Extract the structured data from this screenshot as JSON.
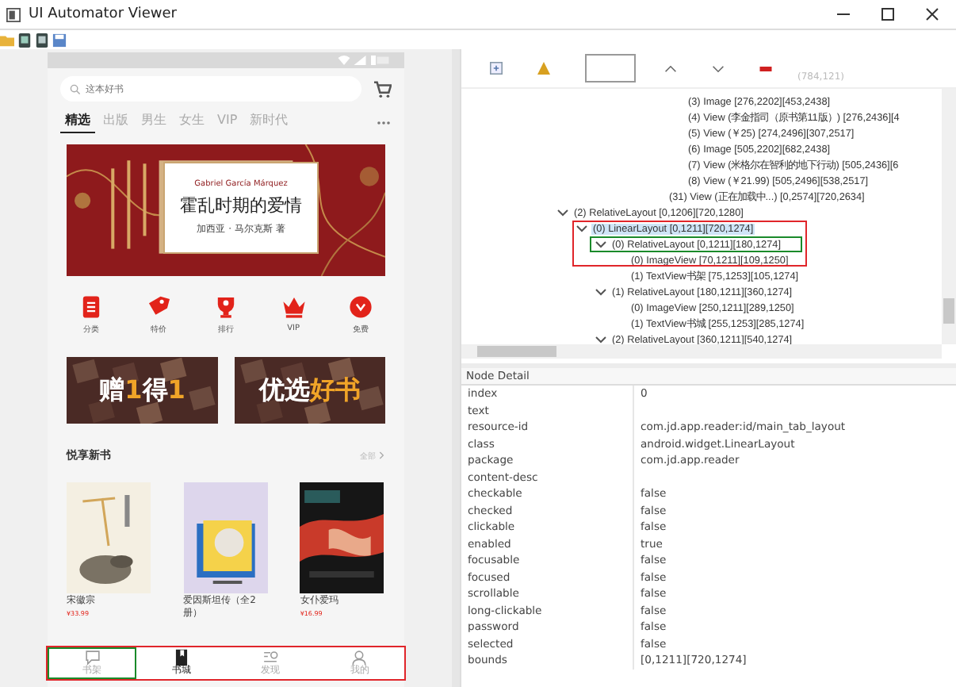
{
  "window": {
    "title": "UI Automator Viewer"
  },
  "phone": {
    "search": {
      "placeholder": "这本好书"
    },
    "tabs": [
      {
        "label": "精选",
        "selected": true
      },
      {
        "label": "出版",
        "selected": false
      },
      {
        "label": "男生",
        "selected": false
      },
      {
        "label": "女生",
        "selected": false
      },
      {
        "label": "VIP",
        "selected": false
      },
      {
        "label": "新时代",
        "selected": false
      }
    ],
    "banner": {
      "author_en": "Gabriel García Márquez",
      "title": "霍乱时期的爱情",
      "byline": "加西亚 · 马尔克斯 著"
    },
    "shortcuts": [
      {
        "label": "分类",
        "kind": "list"
      },
      {
        "label": "特价",
        "kind": "tag"
      },
      {
        "label": "排行",
        "kind": "trophy"
      },
      {
        "label": "VIP",
        "kind": "crown"
      },
      {
        "label": "免费",
        "kind": "gift"
      }
    ],
    "promos": [
      {
        "white": "赠",
        "accent": "1",
        "white2": "得",
        "accent2": "1"
      },
      {
        "white": "优选",
        "accent": "好书"
      }
    ],
    "section": {
      "title": "悦享新书",
      "more": "全部"
    },
    "books": [
      {
        "title": "宋徽宗",
        "price": "¥33.99",
        "kind": "sketch"
      },
      {
        "title": "爱因斯坦传（全2册）",
        "kind": "portrait"
      },
      {
        "title": "女仆爱玛",
        "price": "¥16.99",
        "kind": "dark"
      }
    ],
    "bottom_tabs": [
      {
        "label": "书架",
        "kind": "chat",
        "selected": false
      },
      {
        "label": "书城",
        "kind": "book",
        "selected": true
      },
      {
        "label": "发现",
        "kind": "search",
        "selected": false
      },
      {
        "label": "我的",
        "kind": "person",
        "selected": false
      }
    ]
  },
  "inspector": {
    "coords": "(784,121)",
    "tree": {
      "tail_nodes": [
        {
          "label": "(3) Image [276,2202][453,2438]",
          "selected": false
        },
        {
          "label": "(4) View (李金指司（原书第11版）) [276,2436][4",
          "selected": false
        },
        {
          "label": "(5) View (￥25) [274,2496][307,2517]",
          "selected": false
        },
        {
          "label": "(6) Image [505,2202][682,2438]",
          "selected": false
        },
        {
          "label": "(7) View (米格尔在智利的地下行动) [505,2436][6",
          "selected": false
        },
        {
          "label": "(8) View (￥21.99) [505,2496][538,2517]",
          "selected": false
        }
      ],
      "tail_sibling": {
        "label": "(31) View (正在加载中...) [0,2574][720,2634]",
        "selected": false
      },
      "nodes": [
        {
          "label": "(2) RelativeLayout [0,1206][720,1280]",
          "expanded": true,
          "selected": false,
          "children": [
            {
              "label": "(0) LinearLayout [0,1211][720,1274]",
              "expanded": true,
              "selected": true,
              "children": [
                {
                  "label": "(0) RelativeLayout [0,1211][180,1274]",
                  "expanded": true,
                  "selected": false,
                  "children": [
                    {
                      "label": "(0) ImageView [70,1211][109,1250]",
                      "selected": false
                    },
                    {
                      "label": "(1) TextView书架 [75,1253][105,1274]",
                      "selected": false
                    }
                  ]
                },
                {
                  "label": "(1) RelativeLayout [180,1211][360,1274]",
                  "expanded": true,
                  "selected": false,
                  "children": [
                    {
                      "label": "(0) ImageView [250,1211][289,1250]",
                      "selected": false
                    },
                    {
                      "label": "(1) TextView书城 [255,1253][285,1274]",
                      "selected": false
                    }
                  ]
                },
                {
                  "label": "(2) RelativeLayout [360,1211][540,1274]",
                  "expanded": true,
                  "selected": false
                }
              ]
            }
          ]
        }
      ]
    },
    "detail": {
      "title": "Node Detail",
      "rows": [
        {
          "key": "index",
          "value": "0"
        },
        {
          "key": "text"
        },
        {
          "key": "resource-id",
          "value": "com.jd.app.reader:id/main_tab_layout"
        },
        {
          "key": "class",
          "value": "android.widget.LinearLayout"
        },
        {
          "key": "package",
          "value": "com.jd.app.reader"
        },
        {
          "key": "content-desc"
        },
        {
          "key": "checkable",
          "value": "false"
        },
        {
          "key": "checked",
          "value": "false"
        },
        {
          "key": "clickable",
          "value": "false"
        },
        {
          "key": "enabled",
          "value": "true"
        },
        {
          "key": "focusable",
          "value": "false"
        },
        {
          "key": "focused",
          "value": "false"
        },
        {
          "key": "scrollable",
          "value": "false"
        },
        {
          "key": "long-clickable",
          "value": "false"
        },
        {
          "key": "password",
          "value": "false"
        },
        {
          "key": "selected",
          "value": "false"
        },
        {
          "key": "bounds",
          "value": "[0,1211][720,1274]"
        }
      ]
    }
  }
}
